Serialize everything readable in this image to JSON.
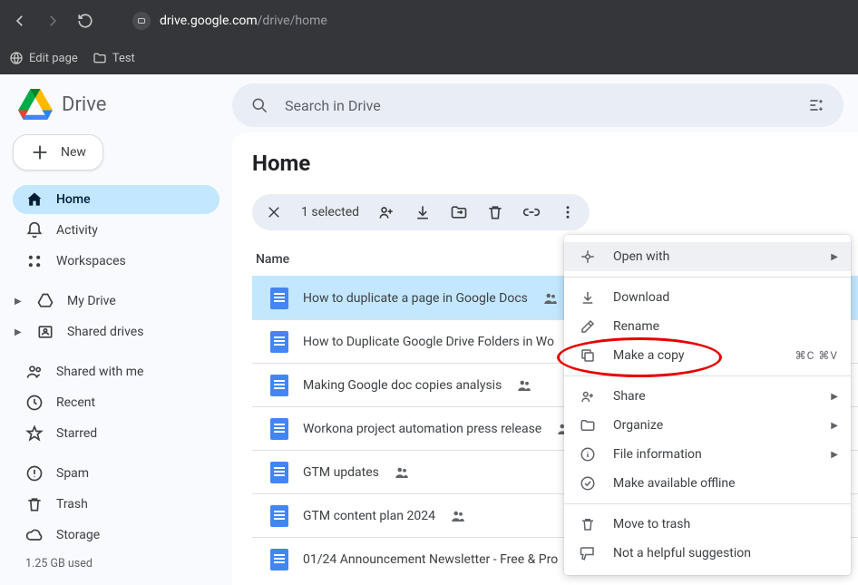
{
  "browser": {
    "url_host": "drive.google.com",
    "url_path": "/drive/home",
    "bookmarks": [
      {
        "label": "Edit page",
        "icon": "globe"
      },
      {
        "label": "Test",
        "icon": "folder"
      }
    ]
  },
  "brand": {
    "name": "Drive"
  },
  "new_button": {
    "label": "New"
  },
  "sidebar": {
    "items": [
      {
        "label": "Home",
        "active": true
      },
      {
        "label": "Activity"
      },
      {
        "label": "Workspaces"
      }
    ],
    "drives": [
      {
        "label": "My Drive"
      },
      {
        "label": "Shared drives"
      }
    ],
    "access": [
      {
        "label": "Shared with me"
      },
      {
        "label": "Recent"
      },
      {
        "label": "Starred"
      }
    ],
    "system": [
      {
        "label": "Spam"
      },
      {
        "label": "Trash"
      },
      {
        "label": "Storage"
      }
    ],
    "storage_used": "1.25 GB used"
  },
  "search": {
    "placeholder": "Search in Drive"
  },
  "page": {
    "title": "Home"
  },
  "selection_bar": {
    "count_label": "1 selected"
  },
  "columns": {
    "name": "Name"
  },
  "files": [
    {
      "title": "How to duplicate a page in Google Docs",
      "shared": true,
      "selected": true
    },
    {
      "title": "How to Duplicate Google Drive Folders in Wo",
      "shared": false
    },
    {
      "title": "Making Google doc copies analysis",
      "shared": true
    },
    {
      "title": "Workona project automation press release",
      "shared": true
    },
    {
      "title": "GTM updates",
      "shared": true
    },
    {
      "title": "GTM content plan 2024",
      "shared": true
    },
    {
      "title": "01/24 Announcement Newsletter - Free & Pro",
      "shared": false
    }
  ],
  "context_menu": {
    "open_with": "Open with",
    "download": "Download",
    "rename": "Rename",
    "make_copy": "Make a copy",
    "make_copy_shortcut": "⌘C ⌘V",
    "share": "Share",
    "organize": "Organize",
    "file_info": "File information",
    "offline": "Make available offline",
    "trash": "Move to trash",
    "not_helpful": "Not a helpful suggestion"
  }
}
